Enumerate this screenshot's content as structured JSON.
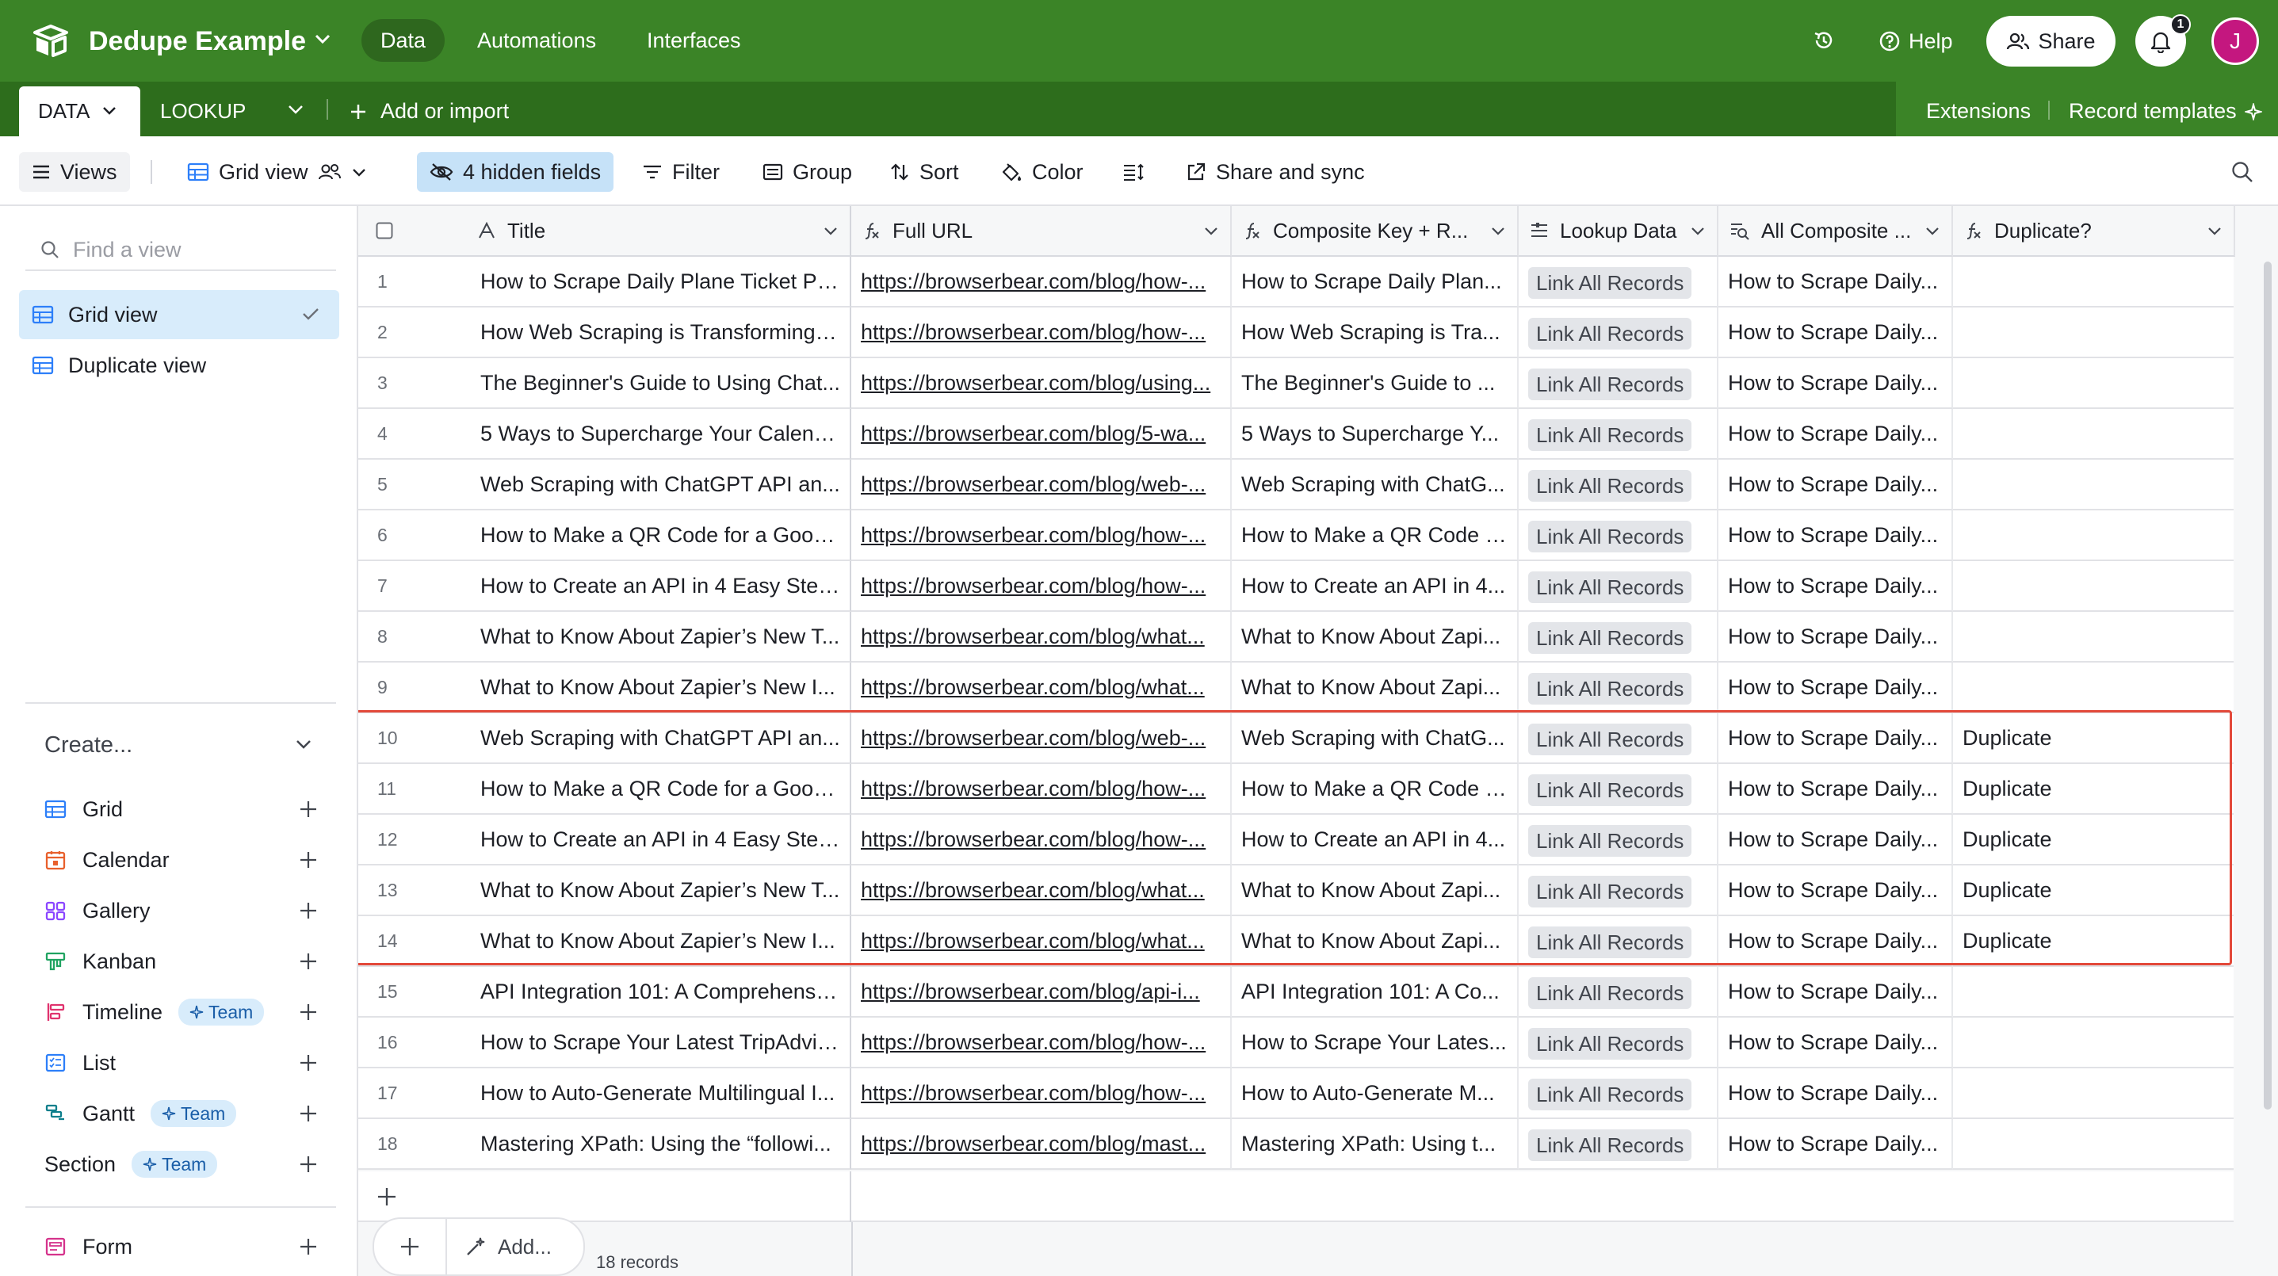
{
  "app": {
    "base_name": "Dedupe Example",
    "nav": [
      "Data",
      "Automations",
      "Interfaces"
    ],
    "help": "Help",
    "share": "Share",
    "notification_count": "1",
    "avatar_initial": "J"
  },
  "tables": {
    "active": "DATA",
    "other": "LOOKUP",
    "add_import": "Add or import",
    "extensions": "Extensions",
    "record_templates": "Record templates"
  },
  "toolbar": {
    "views": "Views",
    "view_name": "Grid view",
    "hidden_fields": "4 hidden fields",
    "filter": "Filter",
    "group": "Group",
    "sort": "Sort",
    "color": "Color",
    "share_sync": "Share and sync"
  },
  "sidebar": {
    "find_placeholder": "Find a view",
    "views": [
      "Grid view",
      "Duplicate view"
    ],
    "create_label": "Create...",
    "create_items": [
      {
        "label": "Grid",
        "team": ""
      },
      {
        "label": "Calendar",
        "team": ""
      },
      {
        "label": "Gallery",
        "team": ""
      },
      {
        "label": "Kanban",
        "team": ""
      },
      {
        "label": "Timeline",
        "team": "Team"
      },
      {
        "label": "List",
        "team": ""
      },
      {
        "label": "Gantt",
        "team": "Team"
      },
      {
        "label": "Section",
        "team": "Team"
      },
      {
        "label": "Form",
        "team": ""
      }
    ]
  },
  "grid": {
    "columns": [
      "Title",
      "Full URL",
      "Composite Key + R...",
      "Lookup Data",
      "All Composite ...",
      "Duplicate?"
    ],
    "rows": [
      {
        "n": "1",
        "title": "How to Scrape Daily Plane Ticket Pri...",
        "url": "https://browserbear.com/blog/how-...",
        "key": "How to Scrape Daily Plan...",
        "lookup": "Link All Records",
        "all": "How to Scrape Daily...",
        "dup": ""
      },
      {
        "n": "2",
        "title": "How Web Scraping is Transforming t...",
        "url": "https://browserbear.com/blog/how-...",
        "key": "How Web Scraping is Tra...",
        "lookup": "Link All Records",
        "all": "How to Scrape Daily...",
        "dup": ""
      },
      {
        "n": "3",
        "title": "The Beginner's Guide to Using Chat...",
        "url": "https://browserbear.com/blog/using...",
        "key": "The Beginner's Guide to ...",
        "lookup": "Link All Records",
        "all": "How to Scrape Daily...",
        "dup": ""
      },
      {
        "n": "4",
        "title": "5 Ways to Supercharge Your Calend...",
        "url": "https://browserbear.com/blog/5-wa...",
        "key": "5 Ways to Supercharge Y...",
        "lookup": "Link All Records",
        "all": "How to Scrape Daily...",
        "dup": ""
      },
      {
        "n": "5",
        "title": "Web Scraping with ChatGPT API an...",
        "url": "https://browserbear.com/blog/web-...",
        "key": "Web Scraping with ChatG...",
        "lookup": "Link All Records",
        "all": "How to Scrape Daily...",
        "dup": ""
      },
      {
        "n": "6",
        "title": "How to Make a QR Code for a Googl...",
        "url": "https://browserbear.com/blog/how-...",
        "key": "How to Make a QR Code f...",
        "lookup": "Link All Records",
        "all": "How to Scrape Daily...",
        "dup": ""
      },
      {
        "n": "7",
        "title": "How to Create an API in 4 Easy Step...",
        "url": "https://browserbear.com/blog/how-...",
        "key": "How to Create an API in 4...",
        "lookup": "Link All Records",
        "all": "How to Scrape Daily...",
        "dup": ""
      },
      {
        "n": "8",
        "title": "What to Know About Zapier’s New T...",
        "url": "https://browserbear.com/blog/what...",
        "key": "What to Know About Zapi...",
        "lookup": "Link All Records",
        "all": "How to Scrape Daily...",
        "dup": ""
      },
      {
        "n": "9",
        "title": "What to Know About Zapier’s New I...",
        "url": "https://browserbear.com/blog/what...",
        "key": "What to Know About Zapi...",
        "lookup": "Link All Records",
        "all": "How to Scrape Daily...",
        "dup": ""
      },
      {
        "n": "10",
        "title": "Web Scraping with ChatGPT API an...",
        "url": "https://browserbear.com/blog/web-...",
        "key": "Web Scraping with ChatG...",
        "lookup": "Link All Records",
        "all": "How to Scrape Daily...",
        "dup": "Duplicate"
      },
      {
        "n": "11",
        "title": "How to Make a QR Code for a Googl...",
        "url": "https://browserbear.com/blog/how-...",
        "key": "How to Make a QR Code f...",
        "lookup": "Link All Records",
        "all": "How to Scrape Daily...",
        "dup": "Duplicate"
      },
      {
        "n": "12",
        "title": "How to Create an API in 4 Easy Step...",
        "url": "https://browserbear.com/blog/how-...",
        "key": "How to Create an API in 4...",
        "lookup": "Link All Records",
        "all": "How to Scrape Daily...",
        "dup": "Duplicate"
      },
      {
        "n": "13",
        "title": "What to Know About Zapier’s New T...",
        "url": "https://browserbear.com/blog/what...",
        "key": "What to Know About Zapi...",
        "lookup": "Link All Records",
        "all": "How to Scrape Daily...",
        "dup": "Duplicate"
      },
      {
        "n": "14",
        "title": "What to Know About Zapier’s New I...",
        "url": "https://browserbear.com/blog/what...",
        "key": "What to Know About Zapi...",
        "lookup": "Link All Records",
        "all": "How to Scrape Daily...",
        "dup": "Duplicate"
      },
      {
        "n": "15",
        "title": "API Integration 101: A Comprehensiv...",
        "url": "https://browserbear.com/blog/api-i...",
        "key": "API Integration 101: A Co...",
        "lookup": "Link All Records",
        "all": "How to Scrape Daily...",
        "dup": ""
      },
      {
        "n": "16",
        "title": "How to Scrape Your Latest TripAdvis...",
        "url": "https://browserbear.com/blog/how-...",
        "key": "How to Scrape Your Lates...",
        "lookup": "Link All Records",
        "all": "How to Scrape Daily...",
        "dup": ""
      },
      {
        "n": "17",
        "title": "How to Auto-Generate Multilingual I...",
        "url": "https://browserbear.com/blog/how-...",
        "key": "How to Auto-Generate M...",
        "lookup": "Link All Records",
        "all": "How to Scrape Daily...",
        "dup": ""
      },
      {
        "n": "18",
        "title": "Mastering XPath: Using the “followi...",
        "url": "https://browserbear.com/blog/mast...",
        "key": "Mastering XPath: Using t...",
        "lookup": "Link All Records",
        "all": "How to Scrape Daily...",
        "dup": ""
      }
    ],
    "add_label": "Add...",
    "records_count": "18 records"
  },
  "colors": {
    "topbar": "#3b8427",
    "tabbar": "#2d6d1c",
    "highlight_border": "#e3493a",
    "hidden_fields_bg": "#c6e2f8"
  }
}
